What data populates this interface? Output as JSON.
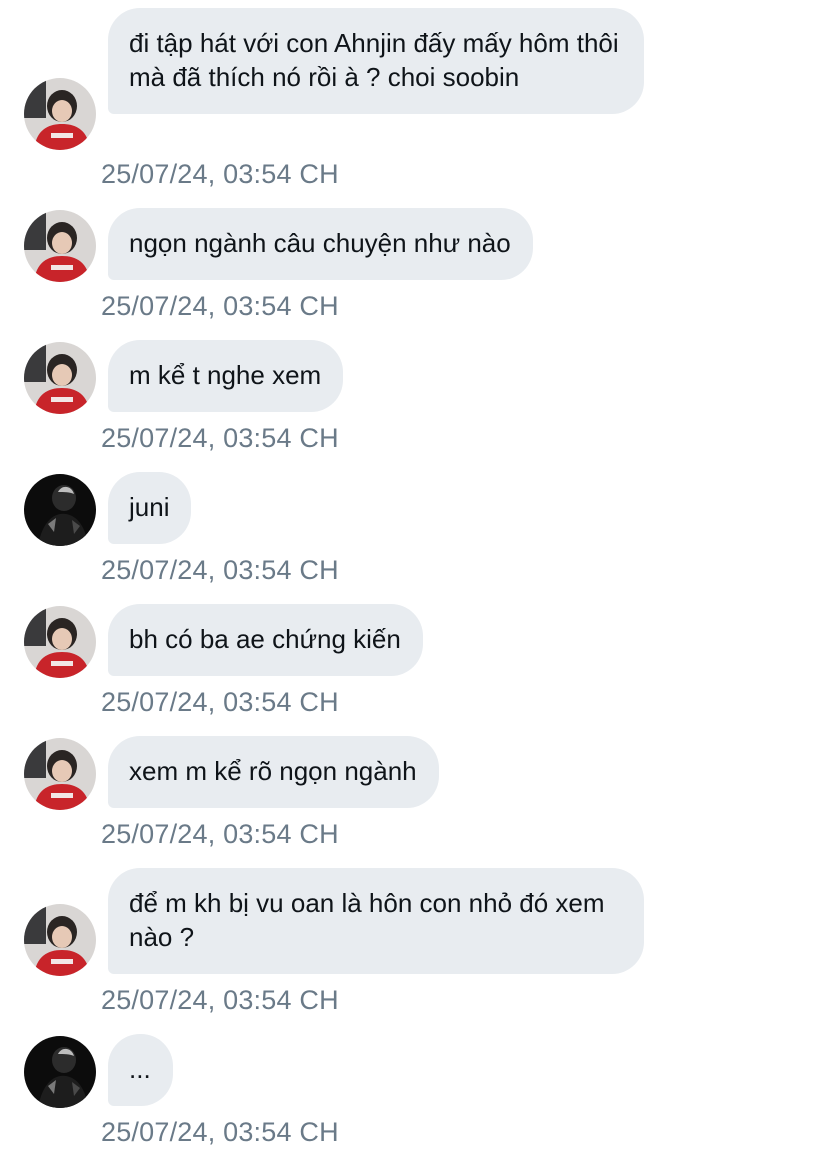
{
  "messages": [
    {
      "sender": "other",
      "text": "đi tập hát với con Ahnjin đấy mấy hôm thôi mà đã thích nó rồi à ? choi soobin",
      "time": "25/07/24, 03:54 CH"
    },
    {
      "sender": "other",
      "text": "ngọn ngành câu chuyện như nào",
      "time": "25/07/24, 03:54 CH"
    },
    {
      "sender": "other",
      "text": "m kể t nghe xem",
      "time": "25/07/24, 03:54 CH"
    },
    {
      "sender": "dark",
      "text": "juni",
      "time": "25/07/24, 03:54 CH"
    },
    {
      "sender": "other",
      "text": "bh có ba ae chứng kiến",
      "time": "25/07/24, 03:54 CH"
    },
    {
      "sender": "other",
      "text": "xem m kể rõ ngọn ngành",
      "time": "25/07/24, 03:54 CH"
    },
    {
      "sender": "other",
      "text": "để m kh bị vu oan là hôn con nhỏ đó xem nào ?",
      "time": "25/07/24, 03:54 CH"
    },
    {
      "sender": "dark",
      "text": "...",
      "time": "25/07/24, 03:54 CH"
    }
  ],
  "colors": {
    "bubble": "#e8ecf0",
    "text": "#0f1419",
    "timestamp": "#6a7a88"
  }
}
